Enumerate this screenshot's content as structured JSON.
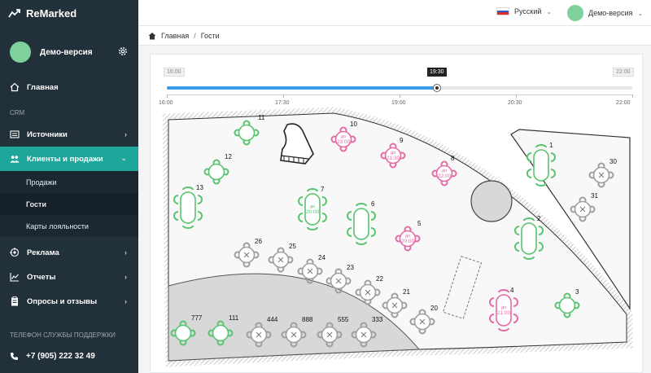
{
  "app": {
    "brand": "ReMarked",
    "brand_color": "#ffffff"
  },
  "user": {
    "name": "Демо-версия"
  },
  "sidebar": {
    "home": "Главная",
    "section_crm": "CRM",
    "sources": "Источники",
    "clients_sales": "Клиенты и продажи",
    "sub_sales": "Продажи",
    "sub_guests": "Гости",
    "sub_loyalty": "Карты лояльности",
    "ads": "Реклама",
    "reports": "Отчеты",
    "surveys": "Опросы и отзывы",
    "support_title": "ТЕЛЕФОН СЛУЖБЫ ПОДДЕРЖКИ",
    "phone": "+7 (905) 222 32 49"
  },
  "topbar": {
    "language": "Русский",
    "user": "Демо-версия"
  },
  "breadcrumb": {
    "home": "Главная",
    "sep": "/",
    "current": "Гости"
  },
  "timeline": {
    "start": "16:00",
    "end": "22:00",
    "current": "19:30",
    "ticks": [
      "16:00",
      "17:30",
      "19:00",
      "20:30",
      "22:00"
    ],
    "progress": 0.58
  },
  "colors": {
    "free": "#58c46f",
    "reserved": "#e56aa6",
    "occupied": "#9e9e9e",
    "accent": "#1fa69a",
    "slider": "#3b9be8"
  },
  "tables": [
    {
      "id": "11",
      "status": "free"
    },
    {
      "id": "10",
      "status": "reserved",
      "text1": "до",
      "text2": "23:00"
    },
    {
      "id": "9",
      "status": "reserved",
      "text1": "до",
      "text2": "21:30"
    },
    {
      "id": "8",
      "status": "reserved",
      "text1": "до",
      "text2": "22:00"
    },
    {
      "id": "12",
      "status": "free"
    },
    {
      "id": "13",
      "status": "free"
    },
    {
      "id": "7",
      "status": "free",
      "text1": "до",
      "text2": "20:00"
    },
    {
      "id": "6",
      "status": "free"
    },
    {
      "id": "5",
      "status": "reserved",
      "text1": "до",
      "text2": "20:00"
    },
    {
      "id": "1",
      "status": "free"
    },
    {
      "id": "30",
      "status": "occupied"
    },
    {
      "id": "31",
      "status": "occupied"
    },
    {
      "id": "2",
      "status": "free"
    },
    {
      "id": "26",
      "status": "occupied"
    },
    {
      "id": "25",
      "status": "occupied"
    },
    {
      "id": "24",
      "status": "occupied"
    },
    {
      "id": "23",
      "status": "occupied"
    },
    {
      "id": "22",
      "status": "occupied"
    },
    {
      "id": "21",
      "status": "occupied"
    },
    {
      "id": "20",
      "status": "occupied"
    },
    {
      "id": "4",
      "status": "reserved",
      "text1": "до",
      "text2": "21:00"
    },
    {
      "id": "3",
      "status": "free"
    },
    {
      "id": "777",
      "status": "free"
    },
    {
      "id": "111",
      "status": "free"
    },
    {
      "id": "444",
      "status": "occupied"
    },
    {
      "id": "888",
      "status": "occupied"
    },
    {
      "id": "555",
      "status": "occupied"
    },
    {
      "id": "333",
      "status": "occupied"
    }
  ]
}
